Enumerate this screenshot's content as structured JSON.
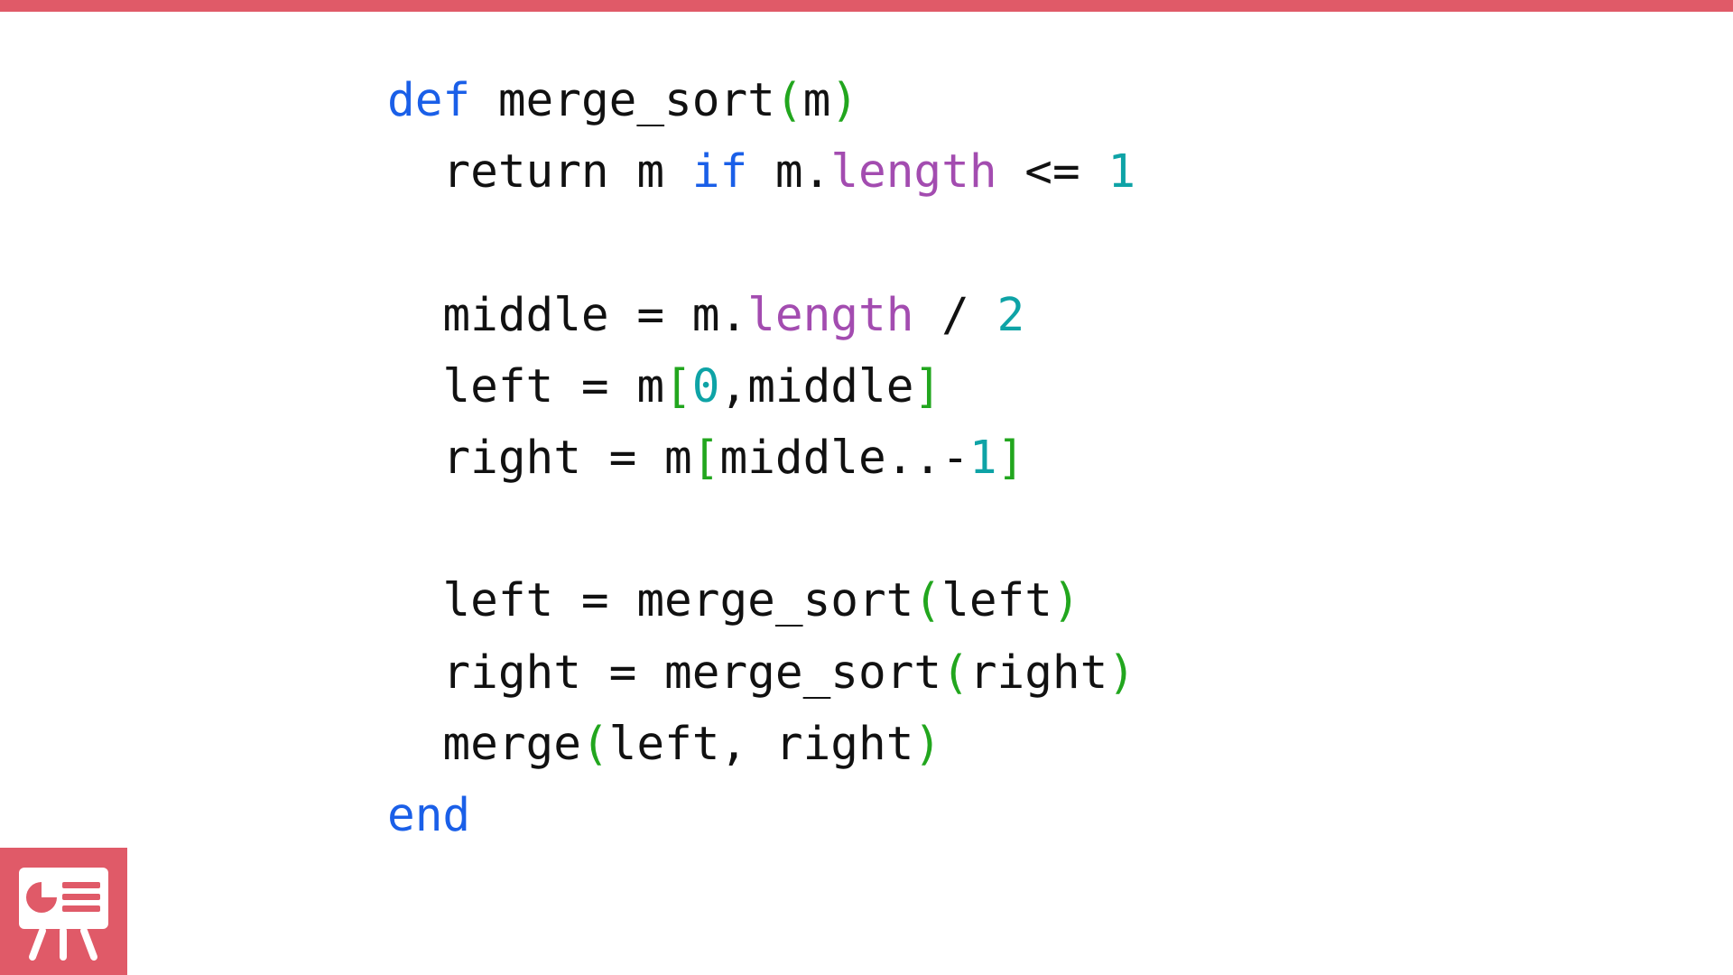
{
  "colors": {
    "accent": "#e05a68",
    "keyword": "#1a5fe8",
    "text": "#111111",
    "paren": "#22a61e",
    "method": "#a34cb0",
    "number": "#0ea3a6"
  },
  "code": {
    "lines": [
      [
        {
          "t": "def",
          "k": "kw"
        },
        {
          "t": " merge_sort",
          "k": "plain"
        },
        {
          "t": "(",
          "k": "paren"
        },
        {
          "t": "m",
          "k": "plain"
        },
        {
          "t": ")",
          "k": "paren"
        }
      ],
      [
        {
          "t": "  return m ",
          "k": "plain"
        },
        {
          "t": "if",
          "k": "kw"
        },
        {
          "t": " m.",
          "k": "plain"
        },
        {
          "t": "length",
          "k": "method"
        },
        {
          "t": " <= ",
          "k": "plain"
        },
        {
          "t": "1",
          "k": "num"
        }
      ],
      [],
      [
        {
          "t": "  middle = m.",
          "k": "plain"
        },
        {
          "t": "length",
          "k": "method"
        },
        {
          "t": " / ",
          "k": "plain"
        },
        {
          "t": "2",
          "k": "num"
        }
      ],
      [
        {
          "t": "  left = m",
          "k": "plain"
        },
        {
          "t": "[",
          "k": "paren"
        },
        {
          "t": "0",
          "k": "num"
        },
        {
          "t": ",middle",
          "k": "plain"
        },
        {
          "t": "]",
          "k": "paren"
        }
      ],
      [
        {
          "t": "  right = m",
          "k": "plain"
        },
        {
          "t": "[",
          "k": "paren"
        },
        {
          "t": "middle..-",
          "k": "plain"
        },
        {
          "t": "1",
          "k": "num"
        },
        {
          "t": "]",
          "k": "paren"
        }
      ],
      [],
      [
        {
          "t": "  left = merge_sort",
          "k": "plain"
        },
        {
          "t": "(",
          "k": "paren"
        },
        {
          "t": "left",
          "k": "plain"
        },
        {
          "t": ")",
          "k": "paren"
        }
      ],
      [
        {
          "t": "  right = merge_sort",
          "k": "plain"
        },
        {
          "t": "(",
          "k": "paren"
        },
        {
          "t": "right",
          "k": "plain"
        },
        {
          "t": ")",
          "k": "paren"
        }
      ],
      [
        {
          "t": "  merge",
          "k": "plain"
        },
        {
          "t": "(",
          "k": "paren"
        },
        {
          "t": "left, right",
          "k": "plain"
        },
        {
          "t": ")",
          "k": "paren"
        }
      ],
      [
        {
          "t": "end",
          "k": "kw"
        }
      ]
    ]
  },
  "badge": {
    "icon": "presentation-icon"
  }
}
